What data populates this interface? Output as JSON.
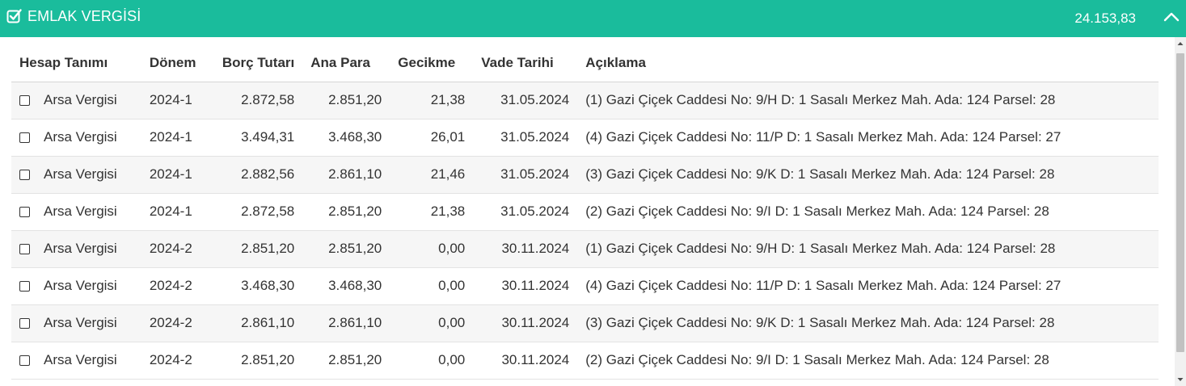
{
  "header": {
    "title": "EMLAK VERGİSİ",
    "total": "24.153,83",
    "icons": [
      "checkbox-checked-icon",
      "chevron-up-icon"
    ],
    "background_color": "#1abc9c"
  },
  "table": {
    "columns": [
      "Hesap Tanımı",
      "Dönem",
      "Borç Tutarı",
      "Ana Para",
      "Gecikme",
      "Vade Tarihi",
      "Açıklama"
    ],
    "rows": [
      {
        "hesap": "Arsa Vergisi",
        "donem": "2024-1",
        "borc": "2.872,58",
        "ana": "2.851,20",
        "gecikme": "21,38",
        "vade": "31.05.2024",
        "aciklama": "(1) Gazi Çiçek Caddesi No: 9/H D: 1 Sasalı Merkez Mah. Ada: 124 Parsel: 28"
      },
      {
        "hesap": "Arsa Vergisi",
        "donem": "2024-1",
        "borc": "3.494,31",
        "ana": "3.468,30",
        "gecikme": "26,01",
        "vade": "31.05.2024",
        "aciklama": "(4) Gazi Çiçek Caddesi No: 11/P D: 1 Sasalı Merkez Mah. Ada: 124 Parsel: 27"
      },
      {
        "hesap": "Arsa Vergisi",
        "donem": "2024-1",
        "borc": "2.882,56",
        "ana": "2.861,10",
        "gecikme": "21,46",
        "vade": "31.05.2024",
        "aciklama": "(3) Gazi Çiçek Caddesi No: 9/K D: 1 Sasalı Merkez Mah. Ada: 124 Parsel: 28"
      },
      {
        "hesap": "Arsa Vergisi",
        "donem": "2024-1",
        "borc": "2.872,58",
        "ana": "2.851,20",
        "gecikme": "21,38",
        "vade": "31.05.2024",
        "aciklama": "(2) Gazi Çiçek Caddesi No: 9/I D: 1 Sasalı Merkez Mah. Ada: 124 Parsel: 28"
      },
      {
        "hesap": "Arsa Vergisi",
        "donem": "2024-2",
        "borc": "2.851,20",
        "ana": "2.851,20",
        "gecikme": "0,00",
        "vade": "30.11.2024",
        "aciklama": "(1) Gazi Çiçek Caddesi No: 9/H D: 1 Sasalı Merkez Mah. Ada: 124 Parsel: 28"
      },
      {
        "hesap": "Arsa Vergisi",
        "donem": "2024-2",
        "borc": "3.468,30",
        "ana": "3.468,30",
        "gecikme": "0,00",
        "vade": "30.11.2024",
        "aciklama": "(4) Gazi Çiçek Caddesi No: 11/P D: 1 Sasalı Merkez Mah. Ada: 124 Parsel: 27"
      },
      {
        "hesap": "Arsa Vergisi",
        "donem": "2024-2",
        "borc": "2.861,10",
        "ana": "2.861,10",
        "gecikme": "0,00",
        "vade": "30.11.2024",
        "aciklama": "(3) Gazi Çiçek Caddesi No: 9/K D: 1 Sasalı Merkez Mah. Ada: 124 Parsel: 28"
      },
      {
        "hesap": "Arsa Vergisi",
        "donem": "2024-2",
        "borc": "2.851,20",
        "ana": "2.851,20",
        "gecikme": "0,00",
        "vade": "30.11.2024",
        "aciklama": "(2) Gazi Çiçek Caddesi No: 9/I D: 1 Sasalı Merkez Mah. Ada: 124 Parsel: 28"
      }
    ]
  }
}
